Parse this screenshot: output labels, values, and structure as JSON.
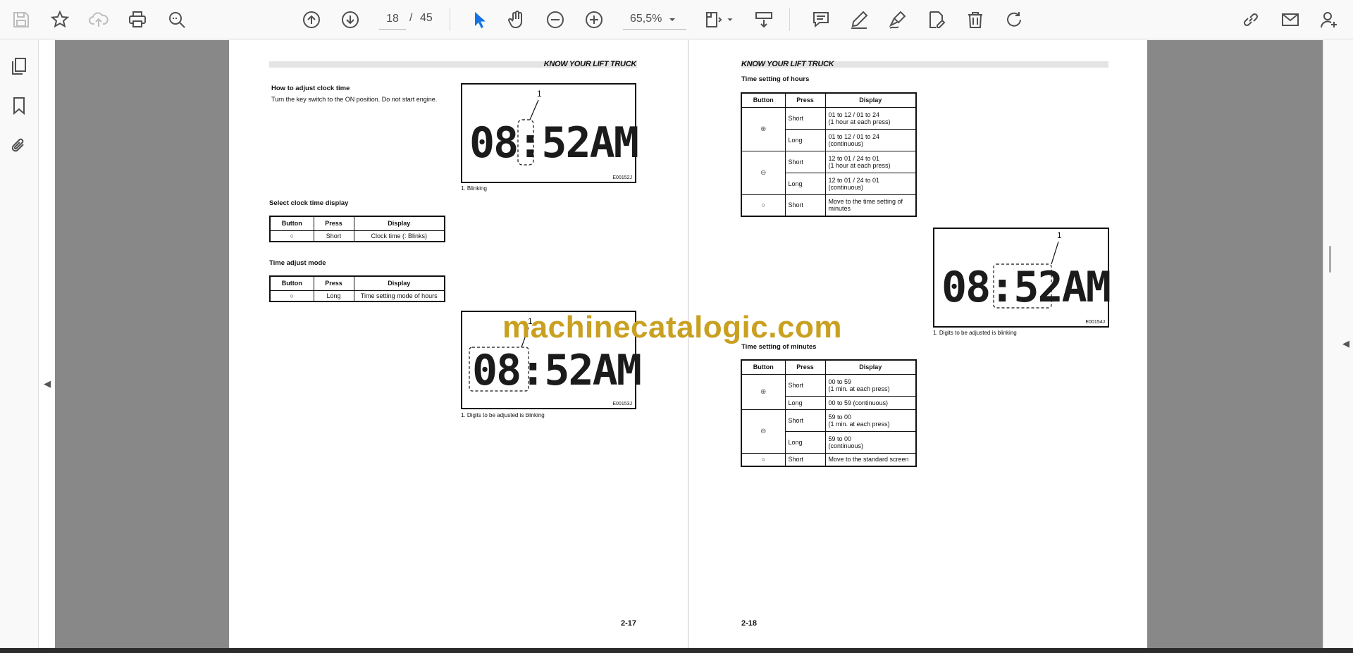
{
  "toolbar": {
    "page_current": "18",
    "page_separator": "/",
    "page_total": "45",
    "zoom": "65,5%",
    "icons": [
      "save-icon",
      "star-icon",
      "cloud-upload-icon",
      "print-icon",
      "zoom-search-icon",
      "arrow-up-icon",
      "arrow-down-icon",
      "select-cursor-icon",
      "hand-icon",
      "zoom-out-icon",
      "zoom-in-icon",
      "chevron-down-icon",
      "fit-page-icon",
      "scroll-mode-icon",
      "comment-icon",
      "pen-icon",
      "sign-icon",
      "edit-pdf-icon",
      "trash-icon",
      "rotate-icon",
      "link-icon",
      "mail-icon",
      "add-user-icon"
    ]
  },
  "sidebar": {
    "icons": [
      "thumbnails-icon",
      "bookmark-icon",
      "attachment-icon"
    ]
  },
  "left_page": {
    "header": "KNOW YOUR LIFT TRUCK",
    "section1_title": "How to adjust clock time",
    "section1_text": "Turn the key switch to the ON position. Do not start engine.",
    "fig1": {
      "mark": "1",
      "display": "08:52AM",
      "code": "E00152J",
      "caption": "1. Blinking"
    },
    "section2_title": "Select clock time display",
    "table1": {
      "headers": [
        "Button",
        "Press",
        "Display"
      ],
      "rows": [
        {
          "button": "○",
          "press": "Short",
          "display": "Clock time (: Blinks)"
        }
      ]
    },
    "section3_title": "Time adjust mode",
    "table2": {
      "headers": [
        "Button",
        "Press",
        "Display"
      ],
      "rows": [
        {
          "button": "○",
          "press": "Long",
          "display": "Time setting mode of hours"
        }
      ]
    },
    "fig2": {
      "mark": "1",
      "display": "08:52AM",
      "code": "E00153J",
      "caption": "1. Digits to be adjusted is blinking"
    },
    "page_number": "2-17"
  },
  "right_page": {
    "header": "KNOW YOUR LIFT TRUCK",
    "section1_title": "Time setting of hours",
    "table1": {
      "headers": [
        "Button",
        "Press",
        "Display"
      ],
      "rows": [
        {
          "button": "⊕",
          "press": "Short",
          "display_1": "01 to 12 / 01 to 24",
          "display_2": "(1 hour at each press)"
        },
        {
          "press": "Long",
          "display_1": "01 to 12 / 01 to 24",
          "display_2": "(continuous)"
        },
        {
          "button": "⊖",
          "press": "Short",
          "display_1": "12 to 01 / 24 to 01",
          "display_2": "(1 hour at each press)"
        },
        {
          "press": "Long",
          "display_1": "12 to 01 / 24 to 01",
          "display_2": "(continuous)"
        },
        {
          "button": "○",
          "press": "Short",
          "display_1": "Move to the time setting of",
          "display_2": "minutes"
        }
      ]
    },
    "fig1": {
      "mark": "1",
      "display": "08:52AM",
      "code": "E00154J",
      "caption": "1. Digits to be adjusted is blinking"
    },
    "section2_title": "Time setting of minutes",
    "table2": {
      "headers": [
        "Button",
        "Press",
        "Display"
      ],
      "rows": [
        {
          "button": "⊕",
          "press": "Short",
          "display_1": "00 to 59",
          "display_2": " (1 min. at each press)"
        },
        {
          "press": "Long",
          "display_1": "00 to 59 (continuous)"
        },
        {
          "button": "⊖",
          "press": "Short",
          "display_1": "59 to 00",
          "display_2": "(1 min. at each press)"
        },
        {
          "press": "Long",
          "display_1": "59 to 00",
          "display_2": "(continuous)"
        },
        {
          "button": "○",
          "press": "Short",
          "display_1": "Move to the standard screen"
        }
      ]
    },
    "page_number": "2-18"
  },
  "watermark": "machinecatalogic.com",
  "colors": {
    "watermark": "#c9a020",
    "select_tool": "#1473e6",
    "viewport": "#888888"
  }
}
